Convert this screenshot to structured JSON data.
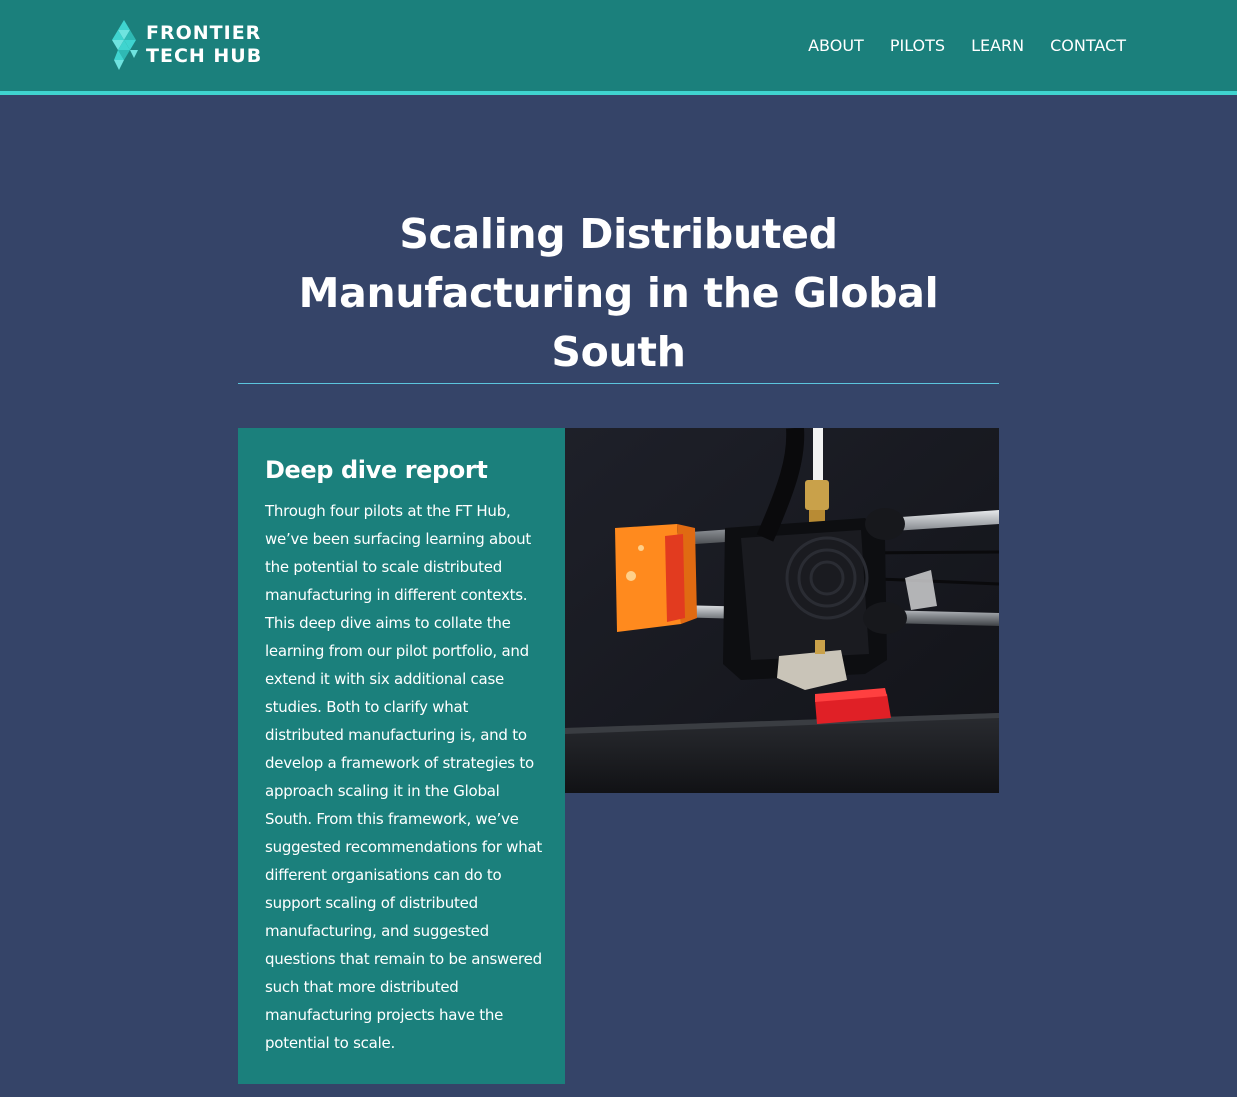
{
  "header": {
    "logo": {
      "line1": "FRONTIER",
      "line2": "TECH HUB"
    },
    "nav": [
      {
        "label": "ABOUT"
      },
      {
        "label": "PILOTS"
      },
      {
        "label": "LEARN"
      },
      {
        "label": "CONTACT"
      }
    ]
  },
  "hero": {
    "title": "Scaling Distributed Manufacturing in the Global South"
  },
  "report": {
    "heading": "Deep dive report",
    "body": "Through four pilots at the FT Hub, we’ve been surfacing learning about the potential to scale distributed manufacturing in different contexts. This deep dive aims to collate the learning from our pilot portfolio, and extend it with six additional case studies. Both to clarify what distributed manufacturing is, and to develop a framework of strategies to approach scaling it in the Global South. From this framework, we’ve suggested recommendations for what different organisations can do to support scaling of distributed manufacturing, and suggested questions that remain to be answered such that more distributed manufacturing projects have the potential to scale."
  },
  "image": {
    "subject": "3d-printer-photo"
  },
  "colors": {
    "page_background": "#354468",
    "header_background": "#1b807c",
    "header_accent": "#3fd4cf",
    "card_background": "#1b807c",
    "divider": "#5cc5dd",
    "text": "#ffffff"
  }
}
